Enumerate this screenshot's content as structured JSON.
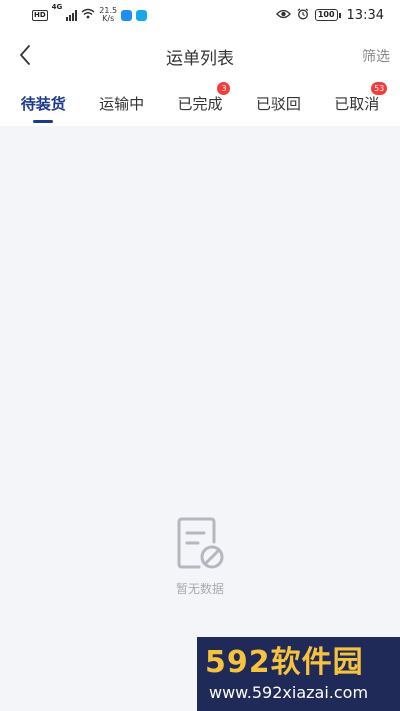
{
  "status_bar": {
    "hd": "HD",
    "net": "4G",
    "speed_value": "21.5",
    "speed_unit": "K/s",
    "battery": "100",
    "time": "13:34"
  },
  "header": {
    "title": "运单列表",
    "filter_label": "筛选"
  },
  "tabs": [
    {
      "label": "待装货",
      "active": true,
      "badge": ""
    },
    {
      "label": "运输中",
      "active": false,
      "badge": ""
    },
    {
      "label": "已完成",
      "active": false,
      "badge": "3"
    },
    {
      "label": "已驳回",
      "active": false,
      "badge": ""
    },
    {
      "label": "已取消",
      "active": false,
      "badge": "53"
    }
  ],
  "empty_state": {
    "text": "暂无数据"
  },
  "watermark": {
    "logo": "592软件园",
    "url": "www.592xiazai.com"
  },
  "colors": {
    "accent": "#1d3a8a",
    "badge": "#f43c3c",
    "background": "#f4f5f9"
  }
}
